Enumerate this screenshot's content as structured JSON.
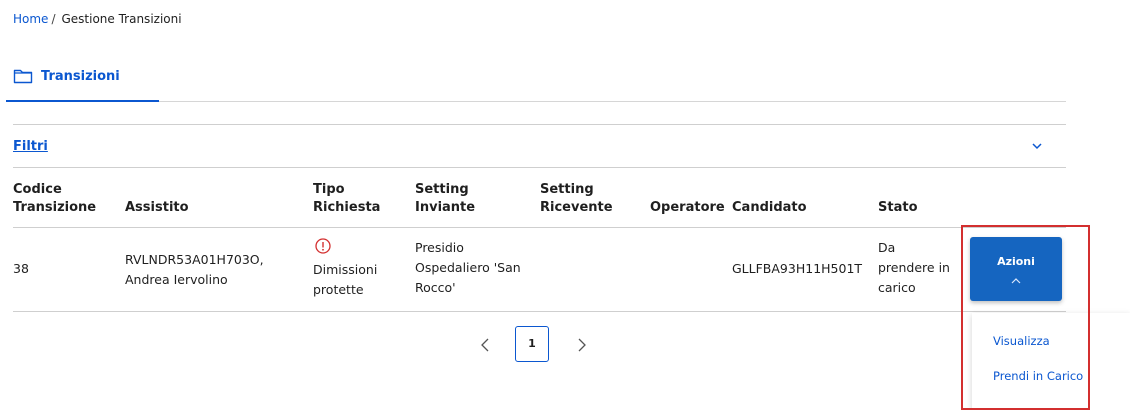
{
  "breadcrumb": {
    "home": "Home",
    "separator": "/",
    "current": "Gestione Transizioni"
  },
  "tabs": [
    {
      "label": "Transizioni",
      "icon": "folder-icon",
      "active": true
    }
  ],
  "filters": {
    "label": "Filtri",
    "icon": "chevron-down-icon",
    "expanded": false
  },
  "table": {
    "headers": {
      "codice": [
        "Codice",
        "Transizione"
      ],
      "assistito": "Assistito",
      "tipo": [
        "Tipo",
        "Richiesta"
      ],
      "inviante": [
        "Setting",
        "Inviante"
      ],
      "ricevente": [
        "Setting",
        "Ricevente"
      ],
      "operatore": "Operatore",
      "candidato": "Candidato",
      "stato": "Stato"
    },
    "rows": [
      {
        "codice": "38",
        "assistito": [
          "RVLNDR53A01H703O,",
          "Andrea Iervolino"
        ],
        "tipo_icon": "warning-circle-icon",
        "tipo": [
          "Dimissioni",
          "protette"
        ],
        "inviante": [
          "Presidio",
          "Ospedaliero 'San",
          "Rocco'"
        ],
        "ricevente": "",
        "operatore": "",
        "candidato": "GLLFBA93H11H501T",
        "stato": [
          "Da",
          "prendere in",
          "carico"
        ],
        "actions_label": "Azioni",
        "actions_icon": "chevron-up-icon"
      }
    ]
  },
  "actions_menu": {
    "open": true,
    "items": [
      "Visualizza",
      "Prendi in Carico"
    ]
  },
  "pagination": {
    "prev_icon": "chevron-left-icon",
    "current_page": "1",
    "next_icon": "chevron-right-icon"
  },
  "colors": {
    "accent": "#0b57d0",
    "button": "#1565c0",
    "highlight": "#d32f2f",
    "warning": "#d32f2f"
  }
}
